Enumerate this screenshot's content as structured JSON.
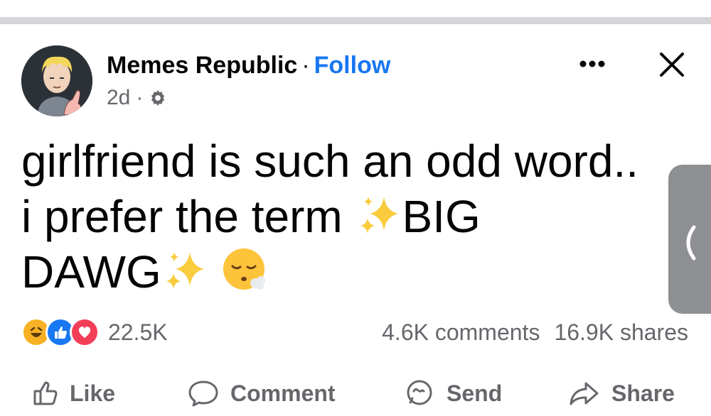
{
  "post": {
    "author": "Memes Republic",
    "separator": "·",
    "follow_label": "Follow",
    "timestamp": "2d",
    "meta_separator": "·",
    "audience_icon": "gear-icon",
    "text_lines": [
      "girlfriend is such an odd word..",
      "i prefer the term",
      "BIG",
      "DAWG"
    ],
    "emoji": [
      "sparkles-icon",
      "face-exhaling-icon"
    ]
  },
  "header_actions": {
    "more_icon": "more-horizontal-icon",
    "close_icon": "close-icon"
  },
  "engagement": {
    "reaction_icons": [
      "haha",
      "like",
      "love"
    ],
    "reaction_count": "22.5K",
    "comments": "4.6K comments",
    "shares": "16.9K shares"
  },
  "action_bar": {
    "like": "Like",
    "comment": "Comment",
    "send": "Send",
    "share": "Share"
  },
  "colors": {
    "brand_blue": "#1877f2",
    "secondary_text": "#65676b",
    "haha": "#f7b125",
    "love": "#f33e58"
  }
}
